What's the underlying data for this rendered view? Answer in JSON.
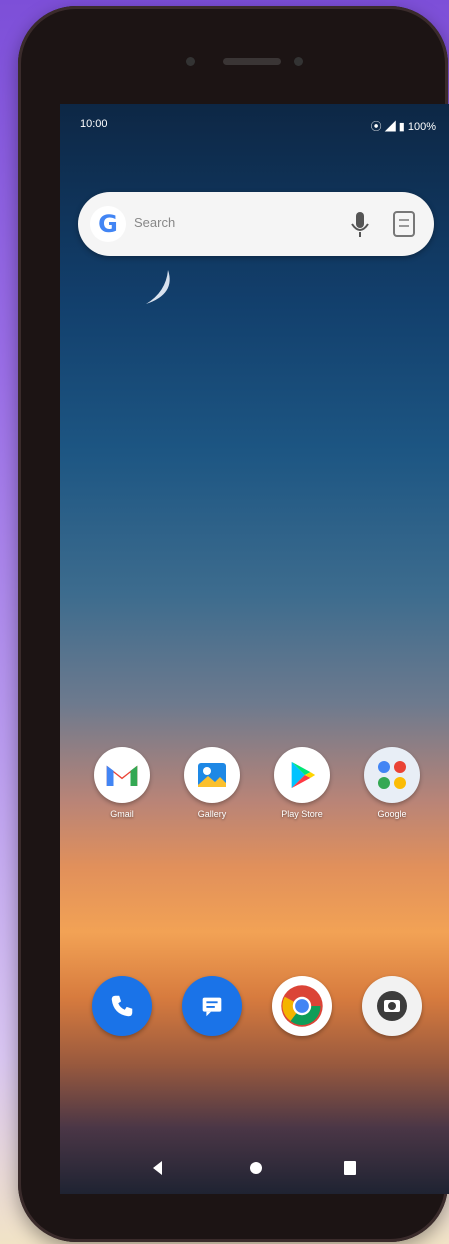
{
  "status_bar": {
    "time": "10:00",
    "icons_text": "⦿ ◢ ▮ 100%"
  },
  "search": {
    "logo": "G",
    "placeholder": "Search"
  },
  "home_apps": [
    {
      "name": "Gmail",
      "icon": "gmail-icon"
    },
    {
      "name": "Gallery",
      "icon": "gallery-icon"
    },
    {
      "name": "Play Store",
      "icon": "play-store-icon"
    },
    {
      "name": "Google",
      "icon": "google-folder-icon"
    }
  ],
  "dock_apps": [
    {
      "icon": "phone-icon"
    },
    {
      "icon": "messages-icon"
    },
    {
      "icon": "chrome-icon"
    },
    {
      "icon": "camera-icon"
    }
  ],
  "navigation": [
    "back",
    "home",
    "recents"
  ],
  "colors": {
    "background_accent": "#7d4fd8",
    "search_bar": "#f5f5f5",
    "phone_body": "#1c1414"
  }
}
